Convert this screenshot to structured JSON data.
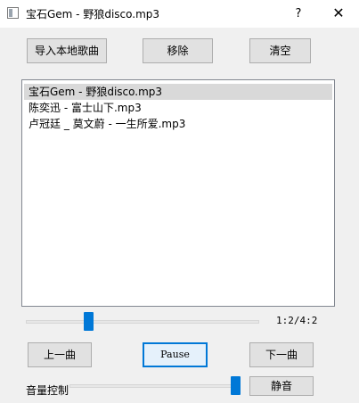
{
  "window": {
    "title": "宝石Gem - 野狼disco.mp3",
    "help_label": "?",
    "close_label": "✕",
    "icon": "app-window-icon"
  },
  "toolbar": {
    "import_label": "导入本地歌曲",
    "remove_label": "移除",
    "clear_label": "清空"
  },
  "playlist": {
    "items": [
      "宝石Gem - 野狼disco.mp3",
      "陈奕迅 - 富士山下.mp3",
      "卢冠廷 _ 莫文蔚 - 一生所爱.mp3"
    ],
    "selected_index": 0
  },
  "progress": {
    "time_text": "1:2/4:2",
    "fraction": 0.26
  },
  "controls": {
    "prev_label": "上一曲",
    "play_label": "Pause",
    "next_label": "下一曲"
  },
  "volume": {
    "label": "音量控制",
    "level": 1.0,
    "mute_label": "静音"
  },
  "colors": {
    "accent": "#0078d7",
    "selection": "#d9d9d9"
  }
}
